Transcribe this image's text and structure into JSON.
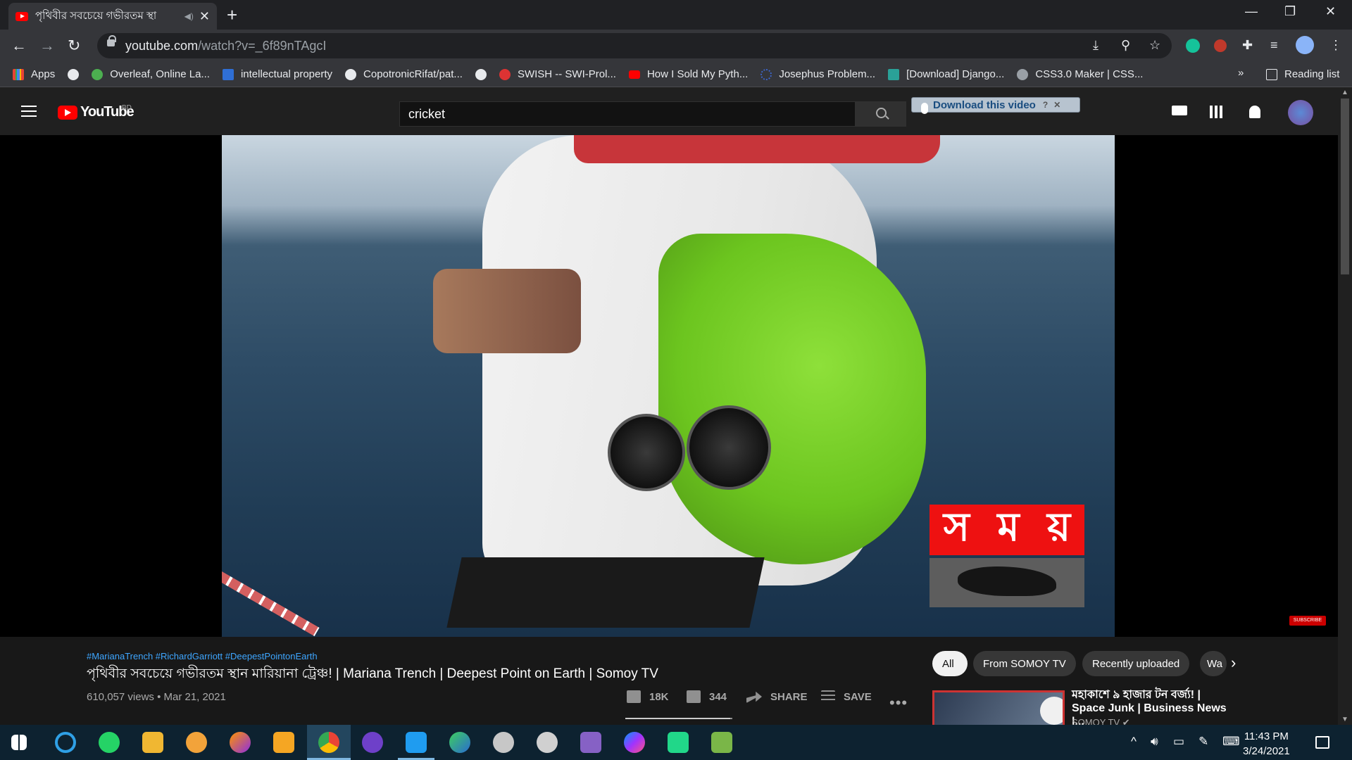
{
  "browser": {
    "tab_title": "পৃথিবীর সবচেয়ে গভীরতম স্থা",
    "new_tab": "+",
    "tab_close": "✕",
    "win_minimize": "—",
    "win_restore": "❐",
    "win_close": "✕",
    "url_host": "youtube.com",
    "url_path": "/watch?v=_6f89nTAgcI",
    "back": "←",
    "forward": "→",
    "reload": "↻",
    "menu": "⋮"
  },
  "bookmarks": {
    "apps": "Apps",
    "items": [
      {
        "label": "Overleaf, Online La...",
        "color": "#4caf50"
      },
      {
        "label": "intellectual property",
        "color": "#2f6fd6"
      },
      {
        "label": "CopotronicRifat/pat...",
        "color": "#e8eaed"
      },
      {
        "label": "SWISH -- SWI-Prol...",
        "color": "#d33"
      },
      {
        "label": "How I Sold My Pyth...",
        "color": "#ff0000"
      },
      {
        "label": "Josephus Problem...",
        "color": "#3c64c8"
      },
      {
        "label": "[Download] Django...",
        "color": "#2aa198"
      },
      {
        "label": "CSS3.0 Maker | CSS...",
        "color": "#9aa0a6"
      }
    ],
    "overflow": "»",
    "reading_list": "Reading list"
  },
  "youtube": {
    "logo_text": "YouTube",
    "country": "BD",
    "search_value": "cricket",
    "download_label": "Download this video",
    "download_help": "?",
    "download_close": "✕"
  },
  "video": {
    "brand_letters": [
      "স",
      "ম",
      "য়"
    ],
    "subscribe_watermark": "SUBSCRIBE",
    "hashtags": "#MarianaTrench #RichardGarriott #DeepestPointonEarth",
    "title": "পৃথিবীর সবচেয়ে গভীরতম স্থান মারিয়ানা ট্রেঞ্চ! | Mariana Trench | Deepest Point on Earth | Somoy TV",
    "views_date": "610,057 views • Mar 21, 2021",
    "likes": "18K",
    "dislikes": "344",
    "like_ratio": 0.98,
    "share": "SHARE",
    "save": "SAVE",
    "more": "•••"
  },
  "chips": [
    "All",
    "From SOMOY TV",
    "Recently uploaded",
    "Wa"
  ],
  "chip_next": "›",
  "recommended": {
    "title": "মহাকাশে ৯ হাজার টন বর্জ্য! | Space Junk | Business News |...",
    "channel": "SOMOY TV ✔"
  },
  "taskbar": {
    "time": "11:43 PM",
    "date": "3/24/2021",
    "tray_up": "^"
  }
}
